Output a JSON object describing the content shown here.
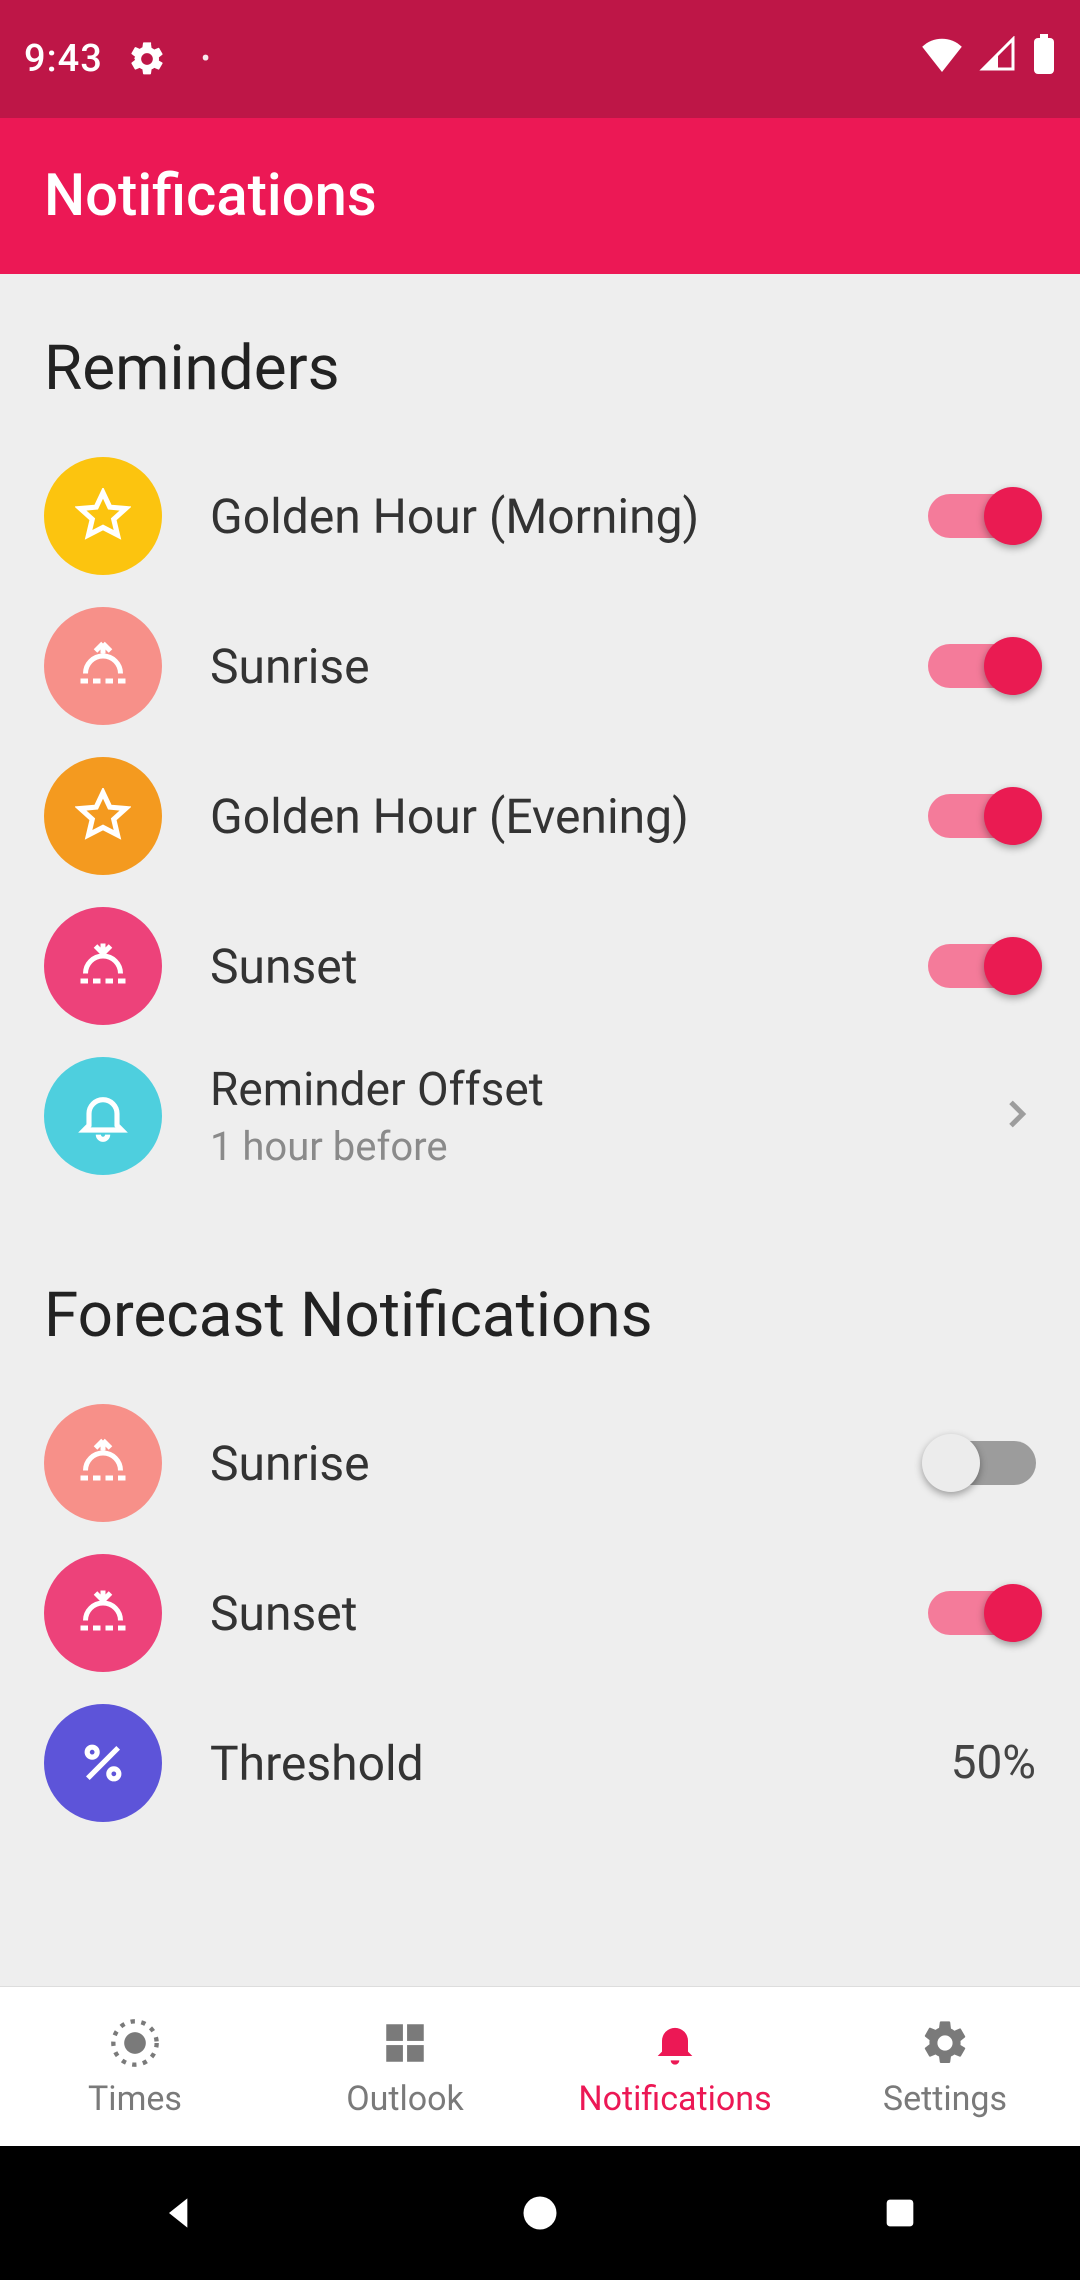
{
  "status": {
    "time": "9:43",
    "gear_icon": "gear",
    "dot": "•"
  },
  "header": {
    "title": "Notifications"
  },
  "sections": {
    "reminders_title": "Reminders",
    "forecast_title": "Forecast Notifications"
  },
  "reminders": {
    "golden_morning": {
      "label": "Golden Hour (Morning)",
      "on": true
    },
    "sunrise": {
      "label": "Sunrise",
      "on": true
    },
    "golden_evening": {
      "label": "Golden Hour (Evening)",
      "on": true
    },
    "sunset": {
      "label": "Sunset",
      "on": true
    },
    "offset": {
      "label": "Reminder Offset",
      "sub": "1 hour before"
    }
  },
  "forecast": {
    "sunrise": {
      "label": "Sunrise",
      "on": false
    },
    "sunset": {
      "label": "Sunset",
      "on": true
    },
    "threshold": {
      "label": "Threshold",
      "value": "50%"
    }
  },
  "tabs": {
    "times": {
      "label": "Times"
    },
    "outlook": {
      "label": "Outlook"
    },
    "notifications": {
      "label": "Notifications"
    },
    "settings": {
      "label": "Settings"
    }
  },
  "colors": {
    "status_bar": "#be1647",
    "header": "#ec1855",
    "accent": "#ea1b52",
    "yellow": "#fcc40f",
    "salmon": "#f79089",
    "orange": "#f49a1f",
    "pink": "#ed427a",
    "teal": "#4ecfde",
    "indigo": "#5d54d9"
  }
}
